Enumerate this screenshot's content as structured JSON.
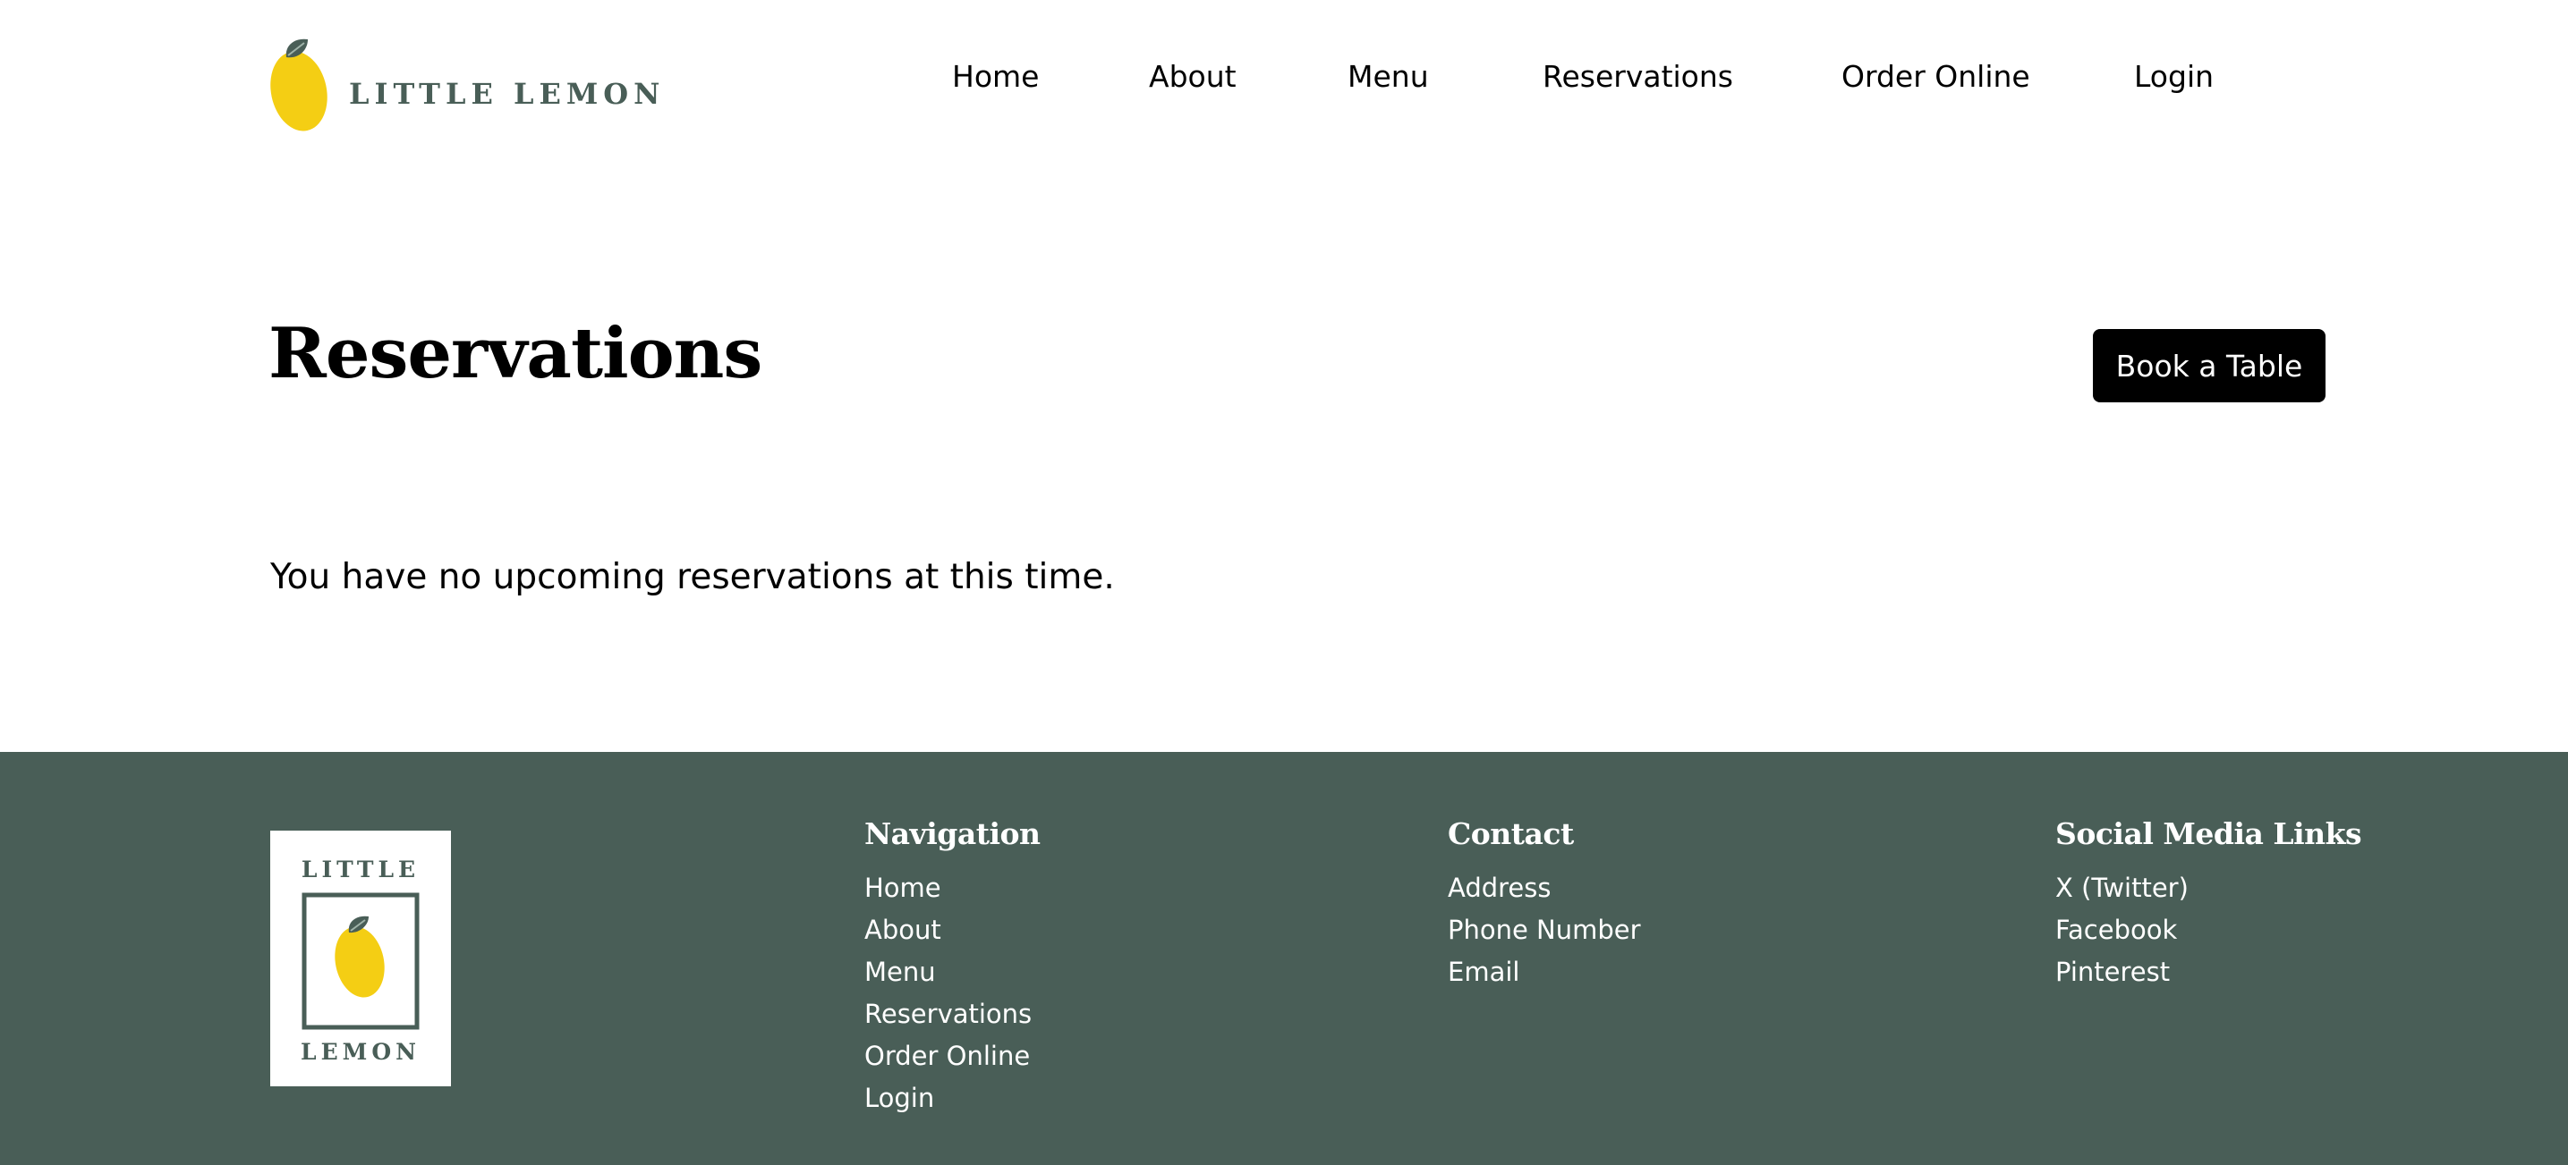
{
  "brand": {
    "name": "LITTLE LEMON",
    "footer_logo_top": "LITTLE",
    "footer_logo_bottom": "LEMON",
    "colors": {
      "primary": "#495e57",
      "lemon": "#f4ce14",
      "leaf": "#495e57",
      "text": "#000000",
      "button": "#000000"
    }
  },
  "nav": {
    "items": [
      {
        "label": "Home"
      },
      {
        "label": "About"
      },
      {
        "label": "Menu"
      },
      {
        "label": "Reservations"
      },
      {
        "label": "Order Online"
      },
      {
        "label": "Login"
      }
    ]
  },
  "main": {
    "title": "Reservations",
    "book_button": "Book a Table",
    "empty_message": "You have no upcoming reservations at this time."
  },
  "footer": {
    "navigation": {
      "heading": "Navigation",
      "links": [
        {
          "label": "Home"
        },
        {
          "label": "About"
        },
        {
          "label": "Menu"
        },
        {
          "label": "Reservations"
        },
        {
          "label": "Order Online"
        },
        {
          "label": "Login"
        }
      ]
    },
    "contact": {
      "heading": "Contact",
      "links": [
        {
          "label": "Address"
        },
        {
          "label": "Phone Number"
        },
        {
          "label": "Email"
        }
      ]
    },
    "social": {
      "heading": "Social Media Links",
      "links": [
        {
          "label": "X (Twitter)"
        },
        {
          "label": "Facebook"
        },
        {
          "label": "Pinterest"
        }
      ]
    }
  },
  "icons": {
    "header_logo": "lemon-icon",
    "footer_logo": "lemon-icon"
  }
}
